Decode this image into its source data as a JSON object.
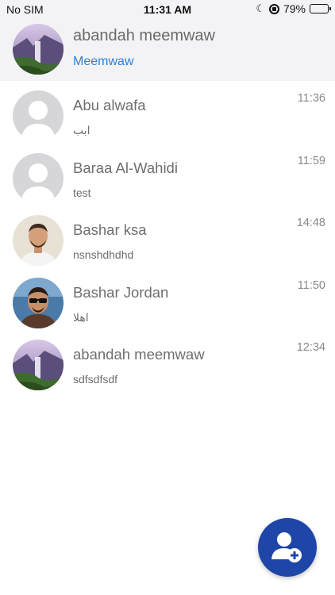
{
  "status_bar": {
    "carrier": "No SIM",
    "time": "11:31 AM",
    "battery": "79%",
    "battery_level": 0.79,
    "icons": [
      "moon-icon",
      "orientation-lock-icon",
      "battery-icon"
    ]
  },
  "profile": {
    "name": "abandah meemwaw",
    "status": "Meemwaw",
    "avatar": "waterfall-photo"
  },
  "chats": [
    {
      "name": "Abu alwafa",
      "message": "ابب",
      "time": "11:36",
      "avatar": "default-person-icon"
    },
    {
      "name": "Baraa Al-Wahidi",
      "message": "test",
      "time": "11:59",
      "avatar": "default-person-icon"
    },
    {
      "name": "Bashar ksa",
      "message": "nsnshdhdhd",
      "time": "14:48",
      "avatar": "person-photo"
    },
    {
      "name": "Bashar Jordan",
      "message": "اهلا",
      "time": "11:50",
      "avatar": "person-sunglasses-photo"
    },
    {
      "name": "abandah meemwaw",
      "message": "sdfsdfsdf",
      "time": "12:34",
      "avatar": "waterfall-photo"
    }
  ],
  "fab": {
    "icon": "add-contact-icon"
  },
  "colors": {
    "accent_blue": "#2b7fd6",
    "fab_blue": "#1d46a8",
    "header_bg": "#f3f3f6"
  }
}
